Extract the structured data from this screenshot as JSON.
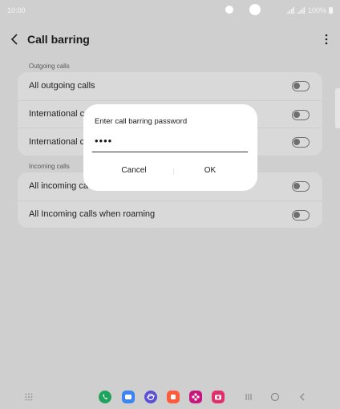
{
  "status": {
    "time": "10:00",
    "battery": "100%"
  },
  "header": {
    "title": "Call barring"
  },
  "sections": [
    {
      "label": "Outgoing calls",
      "rows": [
        {
          "label": "All outgoing calls"
        },
        {
          "label": "International c"
        },
        {
          "label": "International c"
        }
      ]
    },
    {
      "label": "Incoming calls",
      "rows": [
        {
          "label": "All incoming ca"
        },
        {
          "label": "All Incoming calls when roaming"
        }
      ]
    }
  ],
  "dialog": {
    "title": "Enter call barring password",
    "password": "••••",
    "cancel": "Cancel",
    "ok": "OK"
  },
  "dock": [
    {
      "icon": "phone-icon",
      "color": "#1fa35c"
    },
    {
      "icon": "messages-icon",
      "color": "#3c84f2"
    },
    {
      "icon": "internet-icon",
      "color": "#5a4fd6"
    },
    {
      "icon": "store-icon",
      "color": "#ff5a3c"
    },
    {
      "icon": "gallery-icon",
      "color": "#c8157d"
    },
    {
      "icon": "camera-icon",
      "color": "#e0306b"
    }
  ]
}
